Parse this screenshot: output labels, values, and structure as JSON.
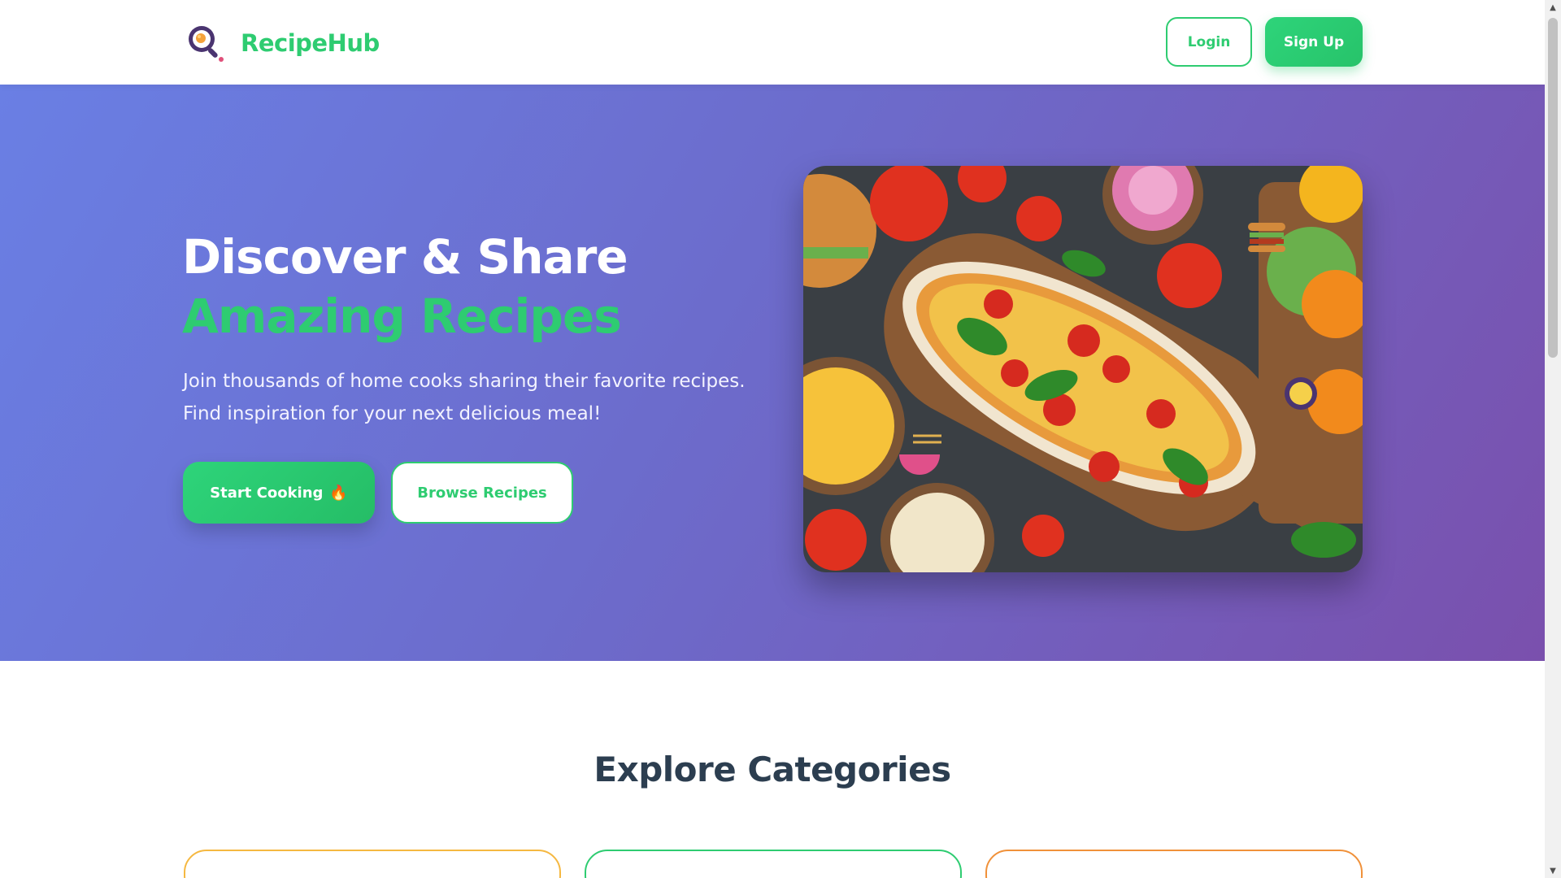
{
  "header": {
    "brand_name": "RecipeHub",
    "login_label": "Login",
    "signup_label": "Sign Up"
  },
  "hero": {
    "title_line1": "Discover & Share",
    "title_line2": "Amazing Recipes",
    "subtitle_line1": "Join thousands of home cooks sharing their favorite recipes.",
    "subtitle_line2": "Find inspiration for your next delicious meal!",
    "start_label": "Start Cooking",
    "start_icon": "🔥",
    "browse_label": "Browse Recipes"
  },
  "categories": {
    "title": "Explore Categories"
  },
  "colors": {
    "accent": "#2ecc71",
    "hero_gradient_start": "#6a7fe4",
    "hero_gradient_end": "#7a50ad",
    "heading": "#2c3e50"
  },
  "icons": {
    "logo": "magnifier-egg-icon",
    "start_button": "fire-icon"
  }
}
